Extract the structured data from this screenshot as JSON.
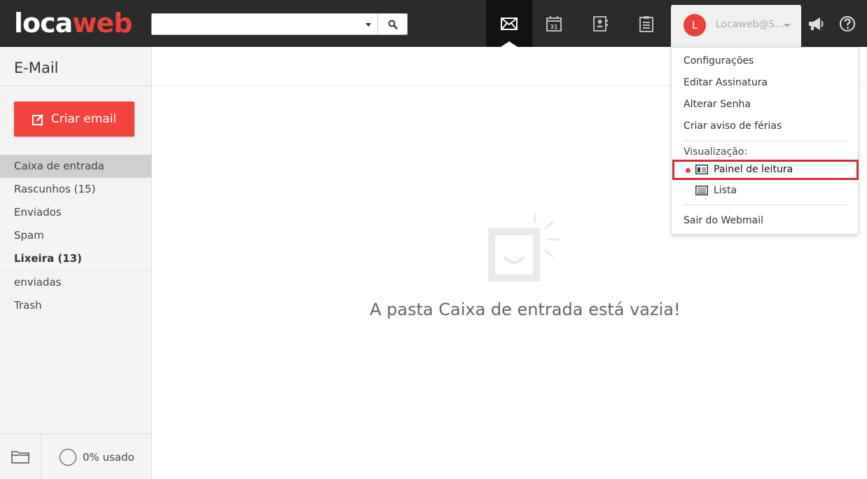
{
  "brand": {
    "logo_part1": "loca",
    "logo_part2": "web"
  },
  "search": {
    "value": "",
    "placeholder": ""
  },
  "user": {
    "initial": "L",
    "name": "Locaweb@S…"
  },
  "sidebar": {
    "title": "E-Mail",
    "compose_label": "Criar email",
    "folders": [
      {
        "label": "Caixa de entrada"
      },
      {
        "label": "Rascunhos (15)"
      },
      {
        "label": "Enviados"
      },
      {
        "label": "Spam"
      },
      {
        "label": "Lixeira (13)"
      },
      {
        "label": "enviadas"
      },
      {
        "label": "Trash"
      }
    ],
    "usage": "0% usado"
  },
  "main": {
    "empty_message": "A pasta Caixa de entrada está vazia!"
  },
  "menu": {
    "items": [
      "Configurações",
      "Editar Assinatura",
      "Alterar Senha",
      "Criar aviso de férias"
    ],
    "view_label": "Visualização:",
    "view_options": [
      "Painel de leitura",
      "Lista"
    ],
    "selected_view": "Painel de leitura",
    "logout": "Sair do Webmail"
  },
  "colors": {
    "accent": "#f0443c",
    "topbar": "#2b2b2b",
    "highlight_border": "#d52b36"
  },
  "icons": [
    "mail-icon",
    "calendar-icon",
    "contacts-icon",
    "tasks-icon",
    "megaphone-icon",
    "help-icon",
    "search-icon",
    "folder-icon",
    "edit-icon"
  ],
  "calendar_day": "31"
}
